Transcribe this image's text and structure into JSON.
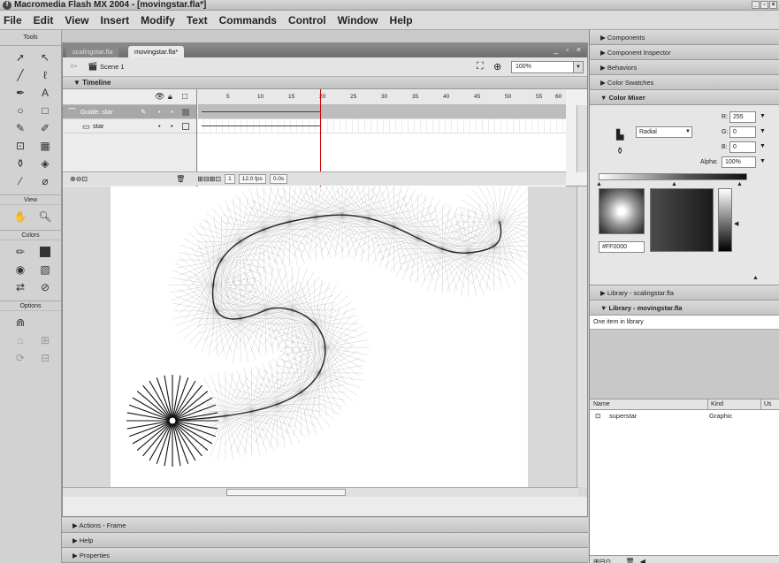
{
  "window": {
    "title": "Macromedia Flash MX 2004 - [movingstar.fla*]"
  },
  "menu": [
    "File",
    "Edit",
    "View",
    "Insert",
    "Modify",
    "Text",
    "Commands",
    "Control",
    "Window",
    "Help"
  ],
  "tools": {
    "header": "Tools",
    "view_label": "View",
    "colors_label": "Colors",
    "options_label": "Options"
  },
  "document": {
    "tabs": [
      "scalingstar.fla",
      "movingstar.fla*"
    ],
    "scene": "Scene 1",
    "zoom": "100%"
  },
  "timeline": {
    "title": "Timeline",
    "layers": [
      {
        "name": "Guide: star",
        "selected": true
      },
      {
        "name": "star",
        "selected": false
      }
    ],
    "frame_numbers": [
      "5",
      "10",
      "15",
      "20",
      "25",
      "30",
      "35",
      "40",
      "45",
      "50",
      "55",
      "60"
    ],
    "current_frame": "1",
    "frame_rate": "12.0 fps",
    "elapsed": "0.0s"
  },
  "bottom_panels": [
    "Actions - Frame",
    "Help",
    "Properties"
  ],
  "right_panels": {
    "collapsed_top": [
      "Components",
      "Component Inspector",
      "Behaviors",
      "Color Swatches"
    ],
    "color_mixer": {
      "title": "Color Mixer",
      "fill_type": "Radial",
      "r_label": "R:",
      "r": "255",
      "g_label": "G:",
      "g": "0",
      "b_label": "B:",
      "b": "0",
      "alpha_label": "Alpha:",
      "alpha": "100%",
      "hex": "#FF0000"
    },
    "library_other": "Library - scalingstar.fla",
    "library": {
      "title": "Library - movingstar.fla",
      "info": "One item in library",
      "col_name": "Name",
      "col_kind": "Kind",
      "col_use": "Us",
      "items": [
        {
          "name": "superstar",
          "kind": "Graphic"
        }
      ]
    }
  }
}
